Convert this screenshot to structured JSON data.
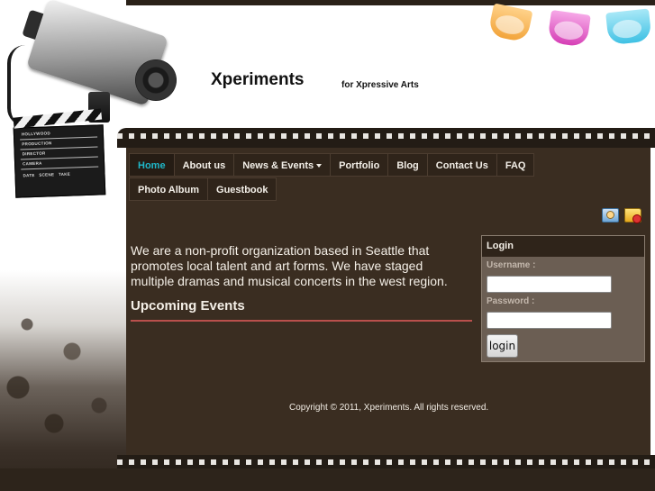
{
  "site": {
    "title": "Xperiments",
    "tagline": "for Xpressive Arts"
  },
  "clapboard": {
    "lines": [
      "HOLLYWOOD",
      "PRODUCTION",
      "DIRECTOR",
      "CAMERA",
      "DATE   SCENE   TAKE"
    ]
  },
  "nav": {
    "items": [
      {
        "label": "Home",
        "active": true
      },
      {
        "label": "About us"
      },
      {
        "label": "News & Events",
        "dropdown": true
      },
      {
        "label": "Portfolio"
      },
      {
        "label": "Blog"
      },
      {
        "label": "Contact Us"
      },
      {
        "label": "FAQ"
      },
      {
        "label": "Photo Album"
      },
      {
        "label": "Guestbook"
      }
    ]
  },
  "toolbar": {
    "icons": [
      "user-account-icon",
      "folder-icon"
    ]
  },
  "main": {
    "intro": "We are a non-profit organization based in Seattle that promotes local talent and art forms. We have staged multiple dramas and musical concerts in the west region.",
    "events_heading": "Upcoming Events"
  },
  "login": {
    "heading": "Login",
    "username_label": "Username :",
    "username_value": "",
    "password_label": "Password :",
    "password_value": "",
    "button_label": "login"
  },
  "footer": {
    "copyright": "Copyright © 2011, Xperiments. All rights reserved."
  },
  "colors": {
    "content_bg": "#3a2d21",
    "nav_active": "#1fb7c9",
    "accent_rule": "#b9504c",
    "film_strip": "#231c15",
    "login_panel": "#6b5e53",
    "light_orange": "#f2a43a",
    "light_magenta": "#d63fb6",
    "light_cyan": "#3fc1e4"
  }
}
